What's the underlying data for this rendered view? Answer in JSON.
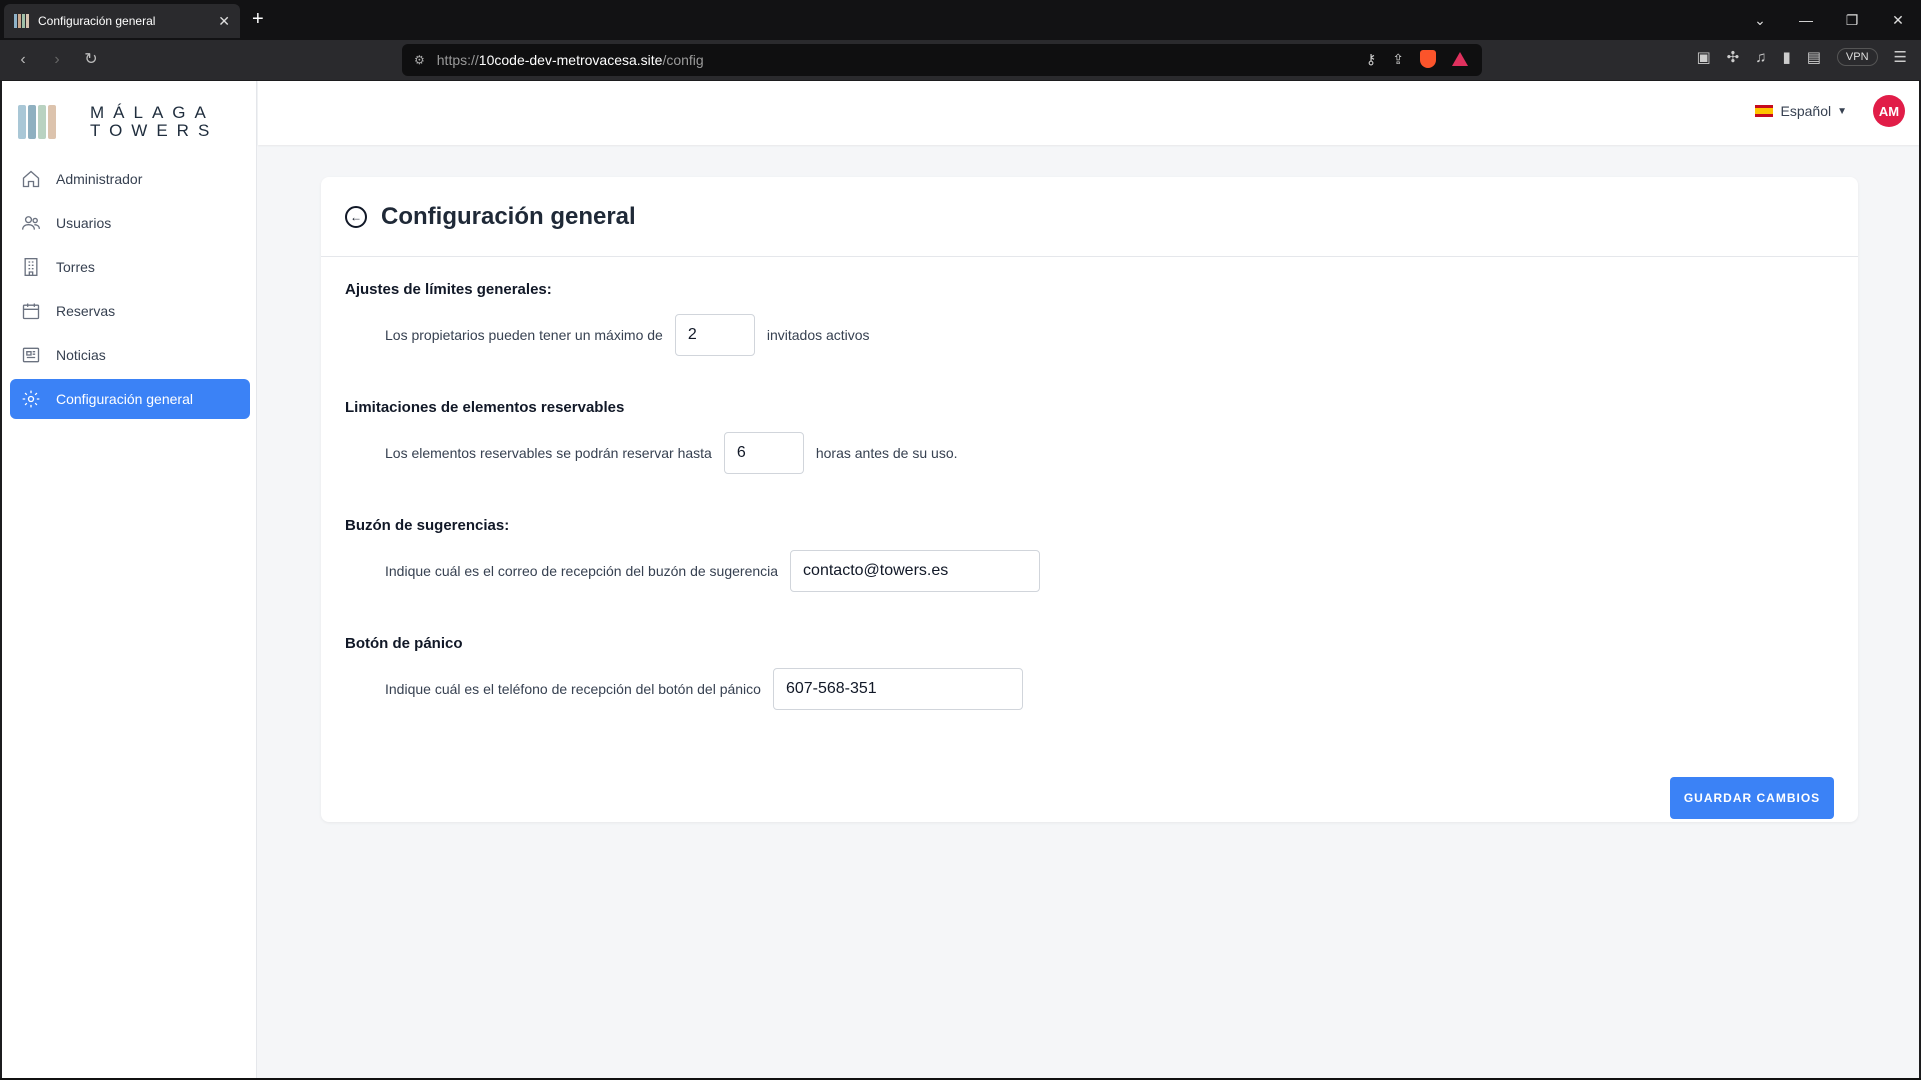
{
  "browser": {
    "tab_title": "Configuración general",
    "url_prefix": "https://",
    "url_host": "10code-dev-metrovacesa.site",
    "url_path": "/config",
    "vpn_label": "VPN"
  },
  "logo": {
    "line1": "MÁLAGA",
    "line2": "TOWERS"
  },
  "sidebar": {
    "items": [
      {
        "label": "Administrador",
        "icon": "home-icon"
      },
      {
        "label": "Usuarios",
        "icon": "users-icon"
      },
      {
        "label": "Torres",
        "icon": "building-icon"
      },
      {
        "label": "Reservas",
        "icon": "calendar-icon"
      },
      {
        "label": "Noticias",
        "icon": "newspaper-icon"
      },
      {
        "label": "Configuración general",
        "icon": "gear-icon",
        "active": true
      }
    ]
  },
  "header": {
    "language": "Español",
    "avatar_initials": "AM"
  },
  "main": {
    "title": "Configuración general",
    "sections": [
      {
        "heading": "Ajustes de límites generales:",
        "prefix": "Los propietarios pueden tener un máximo de",
        "value": "2",
        "suffix": "invitados activos"
      },
      {
        "heading": "Limitaciones de elementos reservables",
        "prefix": "Los elementos reservables se podrán reservar hasta",
        "value": "6",
        "suffix": "horas antes de su uso."
      },
      {
        "heading": "Buzón de sugerencias:",
        "prefix": "Indique cuál es el correo de recepción del buzón de sugerencia",
        "value": "contacto@towers.es"
      },
      {
        "heading": "Botón de pánico",
        "prefix": "Indique cuál es el teléfono de recepción del botón del pánico",
        "value": "607-568-351"
      }
    ],
    "save_label": "GUARDAR CAMBIOS"
  },
  "colors": {
    "accent": "#3b82f6",
    "avatar": "#e11d48"
  }
}
